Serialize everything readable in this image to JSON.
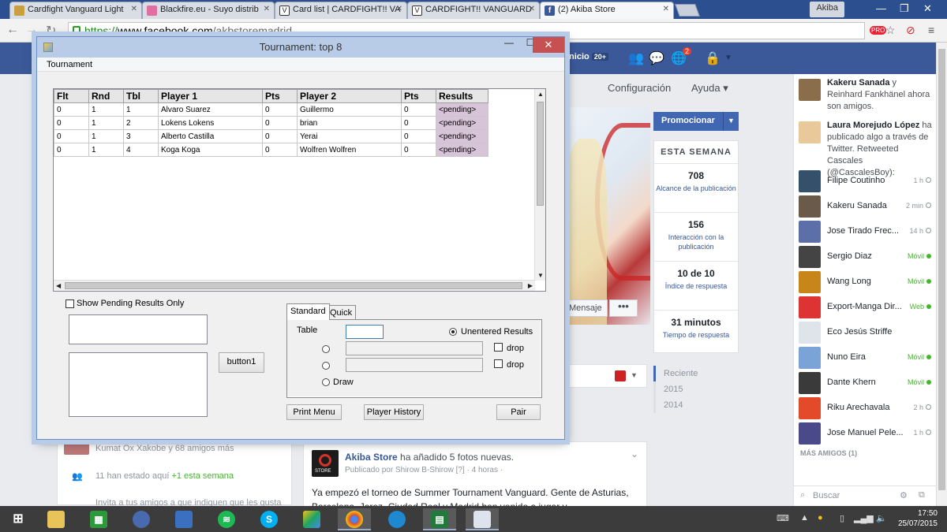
{
  "browser": {
    "tabs": [
      {
        "title": "Cardfight Vanguard Light",
        "color": "#c8a040"
      },
      {
        "title": "Blackfire.eu - Suyo distrib",
        "color": "#e070a0"
      },
      {
        "title": "Card list | CARDFIGHT!! VA",
        "color": "#ffffff"
      },
      {
        "title": "CARDFIGHT!! VANGUARD",
        "color": "#ffffff"
      },
      {
        "title": "(2) Akiba Store",
        "color": "#3b5998"
      }
    ],
    "user": "Akiba",
    "url": {
      "protocol": "https://",
      "domain": "www.facebook.com",
      "path": "/akbstoremadrid"
    },
    "icons": {
      "back": "back-arrow-icon",
      "forward": "forward-arrow-icon",
      "reload": "reload-icon"
    }
  },
  "facebook": {
    "inicio": "Inicio",
    "inicio_badge": "20+",
    "notif_count": "2",
    "config": "Configuración",
    "ayuda": "Ayuda",
    "message_button": "Mensaje",
    "more_button": "•••",
    "promote_button": "Promocionar",
    "stats_title": "ESTA SEMANA",
    "stats": [
      {
        "value": "708",
        "label": "Alcance de la publicación"
      },
      {
        "value": "156",
        "label": "Interacción con la publicación"
      },
      {
        "value": "10 de 10",
        "label": "Índice de respuesta"
      },
      {
        "value": "31 minutos",
        "label": "Tiempo de respuesta"
      }
    ],
    "years": [
      "Reciente",
      "2015",
      "2014"
    ],
    "left_rows": [
      "Kumat Ox Xakobe y 68 amigos más",
      "11 han estado aquí",
      "+1 esta semana",
      "Invita a tus amigos a que indiquen que les gusta"
    ],
    "post": {
      "page": "Akiba Store",
      "action": "ha añadido 5 fotos nuevas.",
      "sub": "Publicado por Shirow B-Shirow [?] · 4 horas ·",
      "text": "Ya empezó el torneo de Summer Tournament Vanguard. Gente de Asturias, Barcelona, Jerez, Ciudad Real y Madrid han venido a jugar y"
    },
    "activity": [
      {
        "name": "Kakeru Sanada",
        "text": "y Reinhard Fankhänel ahora son amigos."
      },
      {
        "name": "Laura Morejudo López",
        "text": "ha publicado algo a través de Twitter. Retweeted Cascales (@CascalesBoy):"
      }
    ],
    "friends": [
      {
        "name": "Filipe Coutinho",
        "status": "1 h",
        "online": false
      },
      {
        "name": "Kakeru Sanada",
        "status": "2 min",
        "online": false
      },
      {
        "name": "Jose Tirado Frec...",
        "status": "14 h",
        "online": false
      },
      {
        "name": "Sergio Diaz",
        "status": "Móvil",
        "online": true
      },
      {
        "name": "Wang Long",
        "status": "Móvil",
        "online": true
      },
      {
        "name": "Export-Manga Dir...",
        "status": "Web",
        "online": true
      },
      {
        "name": "Eco Jesús Striffe",
        "status": "",
        "online": false
      },
      {
        "name": "Nuno Eira",
        "status": "Móvil",
        "online": true
      },
      {
        "name": "Dante Khern",
        "status": "Móvil",
        "online": true
      },
      {
        "name": "Riku Arechavala",
        "status": "2 h",
        "online": false
      },
      {
        "name": "Jose Manuel Pele...",
        "status": "1 h",
        "online": false
      }
    ],
    "more_friends": "MÁS AMIGOS (1)",
    "chat_search": "Buscar"
  },
  "dialog": {
    "title": "Tournament: top 8",
    "menu": "Tournament",
    "columns": [
      "Flt",
      "Rnd",
      "Tbl",
      "Player 1",
      "Pts",
      "Player 2",
      "Pts",
      "Results"
    ],
    "rows": [
      [
        "0",
        "1",
        "1",
        "Alvaro Suarez",
        "0",
        "Guillermo",
        "0",
        "<pending>"
      ],
      [
        "0",
        "1",
        "2",
        "Lokens Lokens",
        "0",
        "brian",
        "0",
        "<pending>"
      ],
      [
        "0",
        "1",
        "3",
        "Alberto Castilla",
        "0",
        "Yerai",
        "0",
        "<pending>"
      ],
      [
        "0",
        "1",
        "4",
        "Koga Koga",
        "0",
        "Wolfren Wolfren",
        "0",
        "<pending>"
      ]
    ],
    "show_pending_label": "Show Pending Results Only",
    "button1": "button1",
    "tab_standard": "Standard",
    "tab_quick": "Quick",
    "table_label": "Table",
    "unentered_label": "Unentered Results",
    "drop_label": "drop",
    "draw_label": "Draw",
    "print_menu": "Print Menu",
    "player_history": "Player History",
    "pair": "Pair"
  },
  "taskbar": {
    "time": "17:50",
    "date": "25/07/2015"
  }
}
